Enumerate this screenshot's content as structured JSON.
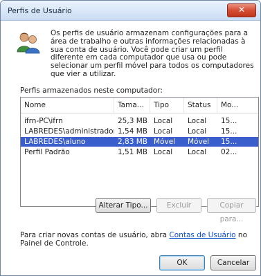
{
  "window": {
    "title": "Perfis de Usuário",
    "close_label": "✕"
  },
  "intro_text": "Os perfis de usuário armazenam configurações para a área de trabalho e outras informações relacionadas à sua conta de usuário. Você pode criar um perfil diferente em cada computador que usa ou pode selecionar um perfil móvel para todos os computadores que vier a utilizar.",
  "list_label": "Perfis armazenados neste computador:",
  "table": {
    "headers": [
      "Nome",
      "Tama...",
      "Tipo",
      "Status",
      "Mo..."
    ],
    "rows": [
      [
        "ifrn-PC\\ifrn",
        "25,3 MB",
        "Local",
        "Local",
        "15..."
      ],
      [
        "LABREDES\\administrador",
        "1,54 MB",
        "Local",
        "Local",
        "15..."
      ],
      [
        "LABREDES\\aluno",
        "2,83 MB",
        "Móvel",
        "Móvel",
        "15..."
      ],
      [
        "Perfil Padrão",
        "1,51 MB",
        "Local",
        "Local",
        "02..."
      ]
    ],
    "selected_row": 2
  },
  "buttons": {
    "change_type": "Alterar Tipo...",
    "delete": "Excluir",
    "copy_to": "Copiar para...",
    "ok": "OK",
    "cancel": "Cancelar"
  },
  "footer": {
    "before_link": "Para criar novas contas de usuário, abra ",
    "link": "Contas de Usuário",
    "after_link": " no Painel de Controle."
  },
  "icons": {
    "users": "users-icon",
    "close": "close-icon"
  },
  "colors": {
    "selection": "#3a5fcd",
    "link": "#0b4ecb",
    "close_button": "#d44d33"
  }
}
